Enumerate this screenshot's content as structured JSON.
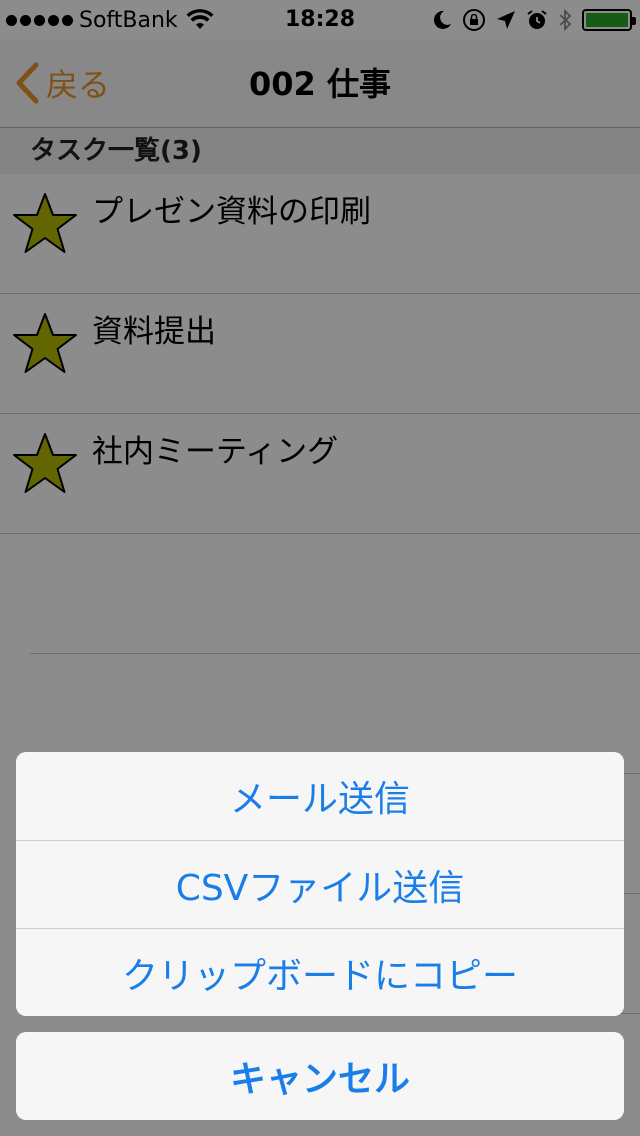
{
  "status_bar": {
    "carrier": "SoftBank",
    "time": "18:28",
    "battery_color": "#2ca52c"
  },
  "nav": {
    "back_label": "戻る",
    "title": "002 仕事"
  },
  "section": {
    "header": "タスク一覧(3)"
  },
  "tasks": [
    {
      "label": "プレゼン資料の印刷"
    },
    {
      "label": "資料提出"
    },
    {
      "label": "社内ミーティング"
    }
  ],
  "action_sheet": {
    "items": [
      {
        "label": "メール送信"
      },
      {
        "label": "CSVファイル送信"
      },
      {
        "label": "クリップボードにコピー"
      }
    ],
    "cancel_label": "キャンセル"
  },
  "colors": {
    "accent_orange": "#e5962a",
    "action_blue": "#1a7ee8",
    "star_fill": "#b5b800"
  }
}
